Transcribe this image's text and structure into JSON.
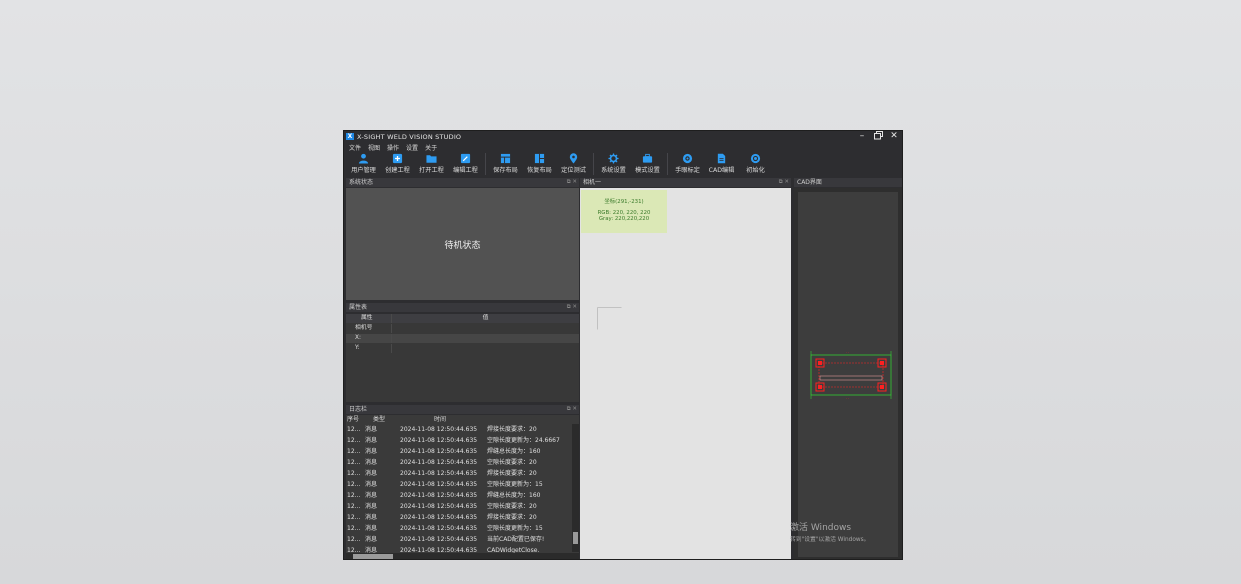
{
  "window": {
    "title": "X-SIGHT WELD VISION STUDIO",
    "logo_text": "X"
  },
  "menu": [
    "文件",
    "视图",
    "操作",
    "设置",
    "关于"
  ],
  "toolbar": [
    {
      "label": "用户管理",
      "icon": "user-icon"
    },
    {
      "label": "创建工程",
      "icon": "plus-icon"
    },
    {
      "label": "打开工程",
      "icon": "folder-icon"
    },
    {
      "label": "编辑工程",
      "icon": "edit-icon"
    },
    {
      "label": "保存布局",
      "icon": "layout-save-icon"
    },
    {
      "label": "恢复布局",
      "icon": "layout-restore-icon"
    },
    {
      "label": "定位测试",
      "icon": "location-icon"
    },
    {
      "label": "系统设置",
      "icon": "gear-icon"
    },
    {
      "label": "模式设置",
      "icon": "briefcase-icon"
    },
    {
      "label": "手眼标定",
      "icon": "target-icon"
    },
    {
      "label": "CAD编辑",
      "icon": "document-icon"
    },
    {
      "label": "初始化",
      "icon": "circle-icon"
    }
  ],
  "panels": {
    "system_status": {
      "title": "系统状态",
      "status": "待机状态"
    },
    "properties": {
      "title": "属性表",
      "col_key": "属性",
      "col_value": "值",
      "rows": [
        {
          "key": "相机号",
          "value": ""
        },
        {
          "key": "X:",
          "value": ""
        },
        {
          "key": "Y:",
          "value": ""
        }
      ]
    },
    "log": {
      "title": "日志栏",
      "col_no": "序号",
      "col_type": "类型",
      "col_time": "时间",
      "col_msg": "",
      "rows": [
        {
          "no": "12...",
          "type": "消息",
          "time": "2024-11-08 12:50:44.635",
          "msg": "焊接长度要求：20"
        },
        {
          "no": "12...",
          "type": "消息",
          "time": "2024-11-08 12:50:44.635",
          "msg": "空隙长度更新为：24.6667"
        },
        {
          "no": "12...",
          "type": "消息",
          "time": "2024-11-08 12:50:44.635",
          "msg": "焊缝总长度为：160"
        },
        {
          "no": "12...",
          "type": "消息",
          "time": "2024-11-08 12:50:44.635",
          "msg": "空隙长度要求：20"
        },
        {
          "no": "12...",
          "type": "消息",
          "time": "2024-11-08 12:50:44.635",
          "msg": "焊接长度要求：20"
        },
        {
          "no": "12...",
          "type": "消息",
          "time": "2024-11-08 12:50:44.635",
          "msg": "空隙长度更新为：15"
        },
        {
          "no": "12...",
          "type": "消息",
          "time": "2024-11-08 12:50:44.635",
          "msg": "焊缝总长度为：160"
        },
        {
          "no": "12...",
          "type": "消息",
          "time": "2024-11-08 12:50:44.635",
          "msg": "空隙长度要求：20"
        },
        {
          "no": "12...",
          "type": "消息",
          "time": "2024-11-08 12:50:44.635",
          "msg": "焊接长度要求：20"
        },
        {
          "no": "12...",
          "type": "消息",
          "time": "2024-11-08 12:50:44.635",
          "msg": "空隙长度更新为：15"
        },
        {
          "no": "12...",
          "type": "消息",
          "time": "2024-11-08 12:50:44.635",
          "msg": "当前CAD配置已保存!"
        },
        {
          "no": "12...",
          "type": "消息",
          "time": "2024-11-08 12:50:44.635",
          "msg": "CADWidgetClose."
        }
      ]
    },
    "camera": {
      "title": "相机一",
      "coord": "坐标(291,-231)",
      "rgb": "RGB: 220, 220, 220",
      "gray": "Gray: 220,220,220"
    },
    "cad": {
      "title": "CAD界面"
    }
  },
  "watermark": {
    "title": "激活 Windows",
    "sub": "转到\"设置\"以激活 Windows。"
  },
  "colors": {
    "accent": "#1e88e5",
    "cad_red": "#ff2020",
    "cad_green": "#33cc33"
  }
}
